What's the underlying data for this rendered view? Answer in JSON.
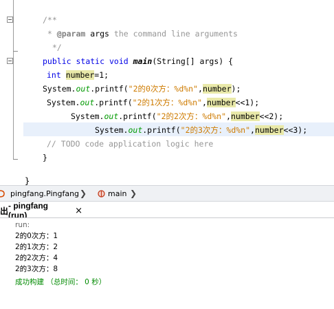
{
  "editor": {
    "comment_open": "/**",
    "comment_param_tag": "@param",
    "comment_param_name": "args",
    "comment_param_desc": "the command line arguments",
    "comment_close": "*/",
    "method_sig": {
      "kw1": "public",
      "kw2": "static",
      "kw3": "void",
      "name": "main",
      "params": "(String[] args) {"
    },
    "line_decl": {
      "kw": "int",
      "var": "number",
      "rest": "=1;"
    },
    "lines": [
      {
        "prefix": "System.",
        "field": "out",
        "call": ".printf(",
        "str": "\"2的0次方：%d%n\"",
        "comma": ",",
        "var": "number",
        "rest": ");"
      },
      {
        "prefix": "System.",
        "field": "out",
        "call": ".printf(",
        "str": "\"2的1次方：%d%n\"",
        "comma": ",",
        "var": "number",
        "rest": "<<1);"
      },
      {
        "prefix": "System.",
        "field": "out",
        "call": ".printf(",
        "str": "\"2的2次方：%d%n\"",
        "comma": ",",
        "var": "number",
        "rest": "<<2);"
      },
      {
        "prefix": "System.",
        "field": "out",
        "call": ".printf(",
        "str": "\"2的3次方：%d%n\"",
        "comma": ",",
        "var": "number",
        "rest": "<<3);"
      }
    ],
    "todo": "// TODO code application logic here",
    "close_brace": "}",
    "outer_brace": "}"
  },
  "breadcrumb": {
    "class_path": "pingfang.Pingfang",
    "method": "main"
  },
  "output_tab": {
    "title_prefix": "出",
    "title": " - pingfang (run)",
    "close": "×"
  },
  "output": {
    "run_label": "run:",
    "results": [
      "2的0次方：1",
      "2的1次方：2",
      "2的2次方：4",
      "2的3次方：8"
    ],
    "status": "成功构建 （总时间： 0 秒）"
  },
  "colors": {
    "keyword": "#0000e6",
    "string": "#ce7b00",
    "highlight": "#e9e9a9",
    "success": "#008a00"
  }
}
